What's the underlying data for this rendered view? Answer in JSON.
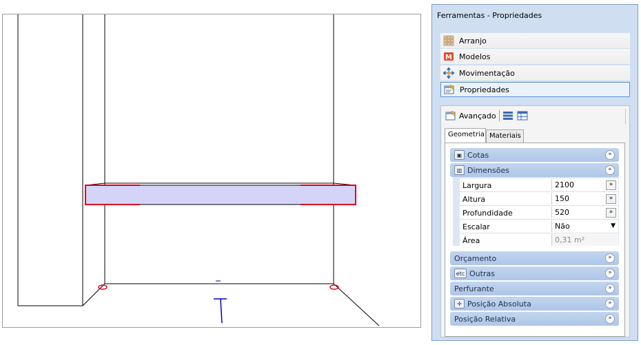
{
  "panel": {
    "title": "Ferramentas - Propriedades",
    "tools": [
      {
        "label": "Arranjo",
        "icon": "arrangement-icon"
      },
      {
        "label": "Modelos",
        "icon": "models-icon"
      },
      {
        "label": "Movimentação",
        "icon": "move-icon"
      },
      {
        "label": "Propriedades",
        "icon": "properties-icon"
      }
    ],
    "advanced_label": "Avançado",
    "tabs": [
      "Geometria",
      "Materiais"
    ],
    "sections": {
      "cotas": "Cotas",
      "dimensoes": "Dimensões",
      "orcamento": "Orçamento",
      "outras": "Outras",
      "outras_icon_text": "etc",
      "perfurante": "Perfurante",
      "posicao_absoluta": "Posição Absoluta",
      "posicao_relativa": "Posição Relativa"
    },
    "properties": [
      {
        "name": "Largura",
        "value": "2100"
      },
      {
        "name": "Altura",
        "value": "150"
      },
      {
        "name": "Profundidade",
        "value": "520"
      },
      {
        "name": "Escalar",
        "value": "Não"
      },
      {
        "name": "Área",
        "value": "0,31 m²"
      }
    ],
    "colors": {
      "panel_bg": "#cfdff1",
      "section_bg": "#b7cdeb",
      "shelf_fill": "#d4d4f8",
      "shelf_outline": "#e0001a",
      "axis": "#0000c0"
    }
  }
}
